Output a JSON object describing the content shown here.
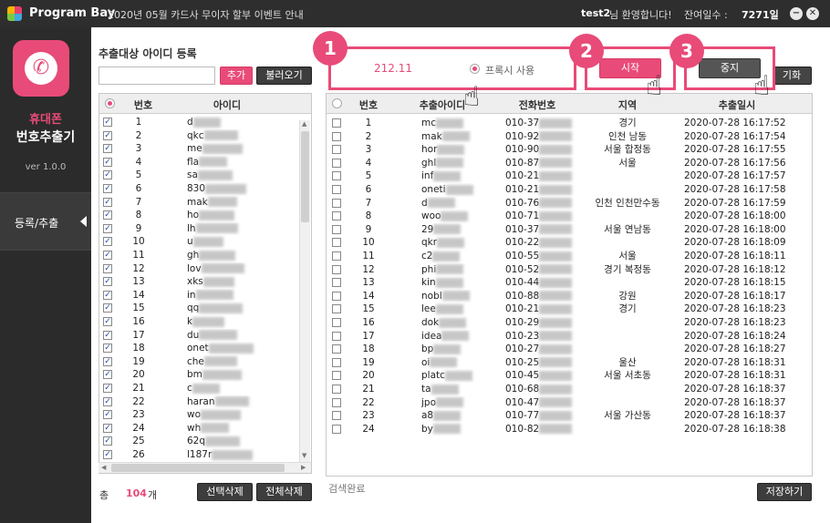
{
  "titlebar": {
    "brand": "Program Bay",
    "notice": "2020년 05월 카드사 무이자 할부 이벤트 안내",
    "user": "test2",
    "greeting": "님 환영합니다!",
    "days_label": "잔여일수 :",
    "days_value": "7271일",
    "minimize": "−",
    "close": "✕"
  },
  "sidebar": {
    "app_name_line1": "휴대폰",
    "app_name_line2": "번호추출기",
    "version": "ver 1.0.0",
    "nav_item": "등록/추출"
  },
  "left_panel": {
    "title": "추출대상 아이디 등록",
    "add_button": "추가",
    "load_button": "불러오기",
    "col_num": "번호",
    "col_id": "아이디",
    "ids": [
      "d",
      "qkc",
      "me",
      "fla",
      "sa",
      "830",
      "mak",
      "ho",
      "lh",
      "u",
      "gh",
      "lov",
      "xks",
      "in",
      "qq",
      "k",
      "du",
      "onet",
      "che",
      "bm",
      "c",
      "haran",
      "wo",
      "wh",
      "62q",
      "l187r"
    ],
    "total_label": "총",
    "total_count": "104",
    "total_unit": "개",
    "delete_selected": "선택삭제",
    "delete_all": "전체삭제"
  },
  "controls": {
    "proxy_ip": "212.11",
    "proxy_label": "프록시 사용",
    "start_button": "시작",
    "stop_button": "중지",
    "reset_button": "기화",
    "badges": [
      "1",
      "2",
      "3"
    ]
  },
  "right_panel": {
    "col_num": "번호",
    "col_id": "추출아이디",
    "col_phone": "전화번호",
    "col_region": "지역",
    "col_time": "추출일시",
    "rows": [
      {
        "id": "mc",
        "phone": "010-37",
        "region": "경기",
        "time": "2020-07-28 16:17:52"
      },
      {
        "id": "mak",
        "phone": "010-92",
        "region": "인천 남동",
        "time": "2020-07-28 16:17:54"
      },
      {
        "id": "hor",
        "phone": "010-90",
        "region": "서울 합정동",
        "time": "2020-07-28 16:17:55"
      },
      {
        "id": "ghl",
        "phone": "010-87",
        "region": "서울",
        "time": "2020-07-28 16:17:56"
      },
      {
        "id": "inf",
        "phone": "010-21",
        "region": "",
        "time": "2020-07-28 16:17:57"
      },
      {
        "id": "oneti",
        "phone": "010-21",
        "region": "",
        "time": "2020-07-28 16:17:58"
      },
      {
        "id": "d",
        "phone": "010-76",
        "region": "인천 인천만수동",
        "time": "2020-07-28 16:17:59"
      },
      {
        "id": "woo",
        "phone": "010-71",
        "region": "",
        "time": "2020-07-28 16:18:00"
      },
      {
        "id": "29",
        "phone": "010-37",
        "region": "서울 연남동",
        "time": "2020-07-28 16:18:00"
      },
      {
        "id": "qkr",
        "phone": "010-22",
        "region": "",
        "time": "2020-07-28 16:18:09"
      },
      {
        "id": "c2",
        "phone": "010-55",
        "region": "서울",
        "time": "2020-07-28 16:18:11"
      },
      {
        "id": "phi",
        "phone": "010-52",
        "region": "경기 복정동",
        "time": "2020-07-28 16:18:12"
      },
      {
        "id": "kin",
        "phone": "010-44",
        "region": "",
        "time": "2020-07-28 16:18:15"
      },
      {
        "id": "nobl",
        "phone": "010-88",
        "region": "강원",
        "time": "2020-07-28 16:18:17"
      },
      {
        "id": "lee",
        "phone": "010-21",
        "region": "경기",
        "time": "2020-07-28 16:18:23"
      },
      {
        "id": "dok",
        "phone": "010-29",
        "region": "",
        "time": "2020-07-28 16:18:23"
      },
      {
        "id": "idea",
        "phone": "010-23",
        "region": "",
        "time": "2020-07-28 16:18:24"
      },
      {
        "id": "bp",
        "phone": "010-27",
        "region": "",
        "time": "2020-07-28 16:18:27"
      },
      {
        "id": "oi",
        "phone": "010-25",
        "region": "울산",
        "time": "2020-07-28 16:18:31"
      },
      {
        "id": "platc",
        "phone": "010-45",
        "region": "서울 서초동",
        "time": "2020-07-28 16:18:31"
      },
      {
        "id": "ta",
        "phone": "010-68",
        "region": "",
        "time": "2020-07-28 16:18:37"
      },
      {
        "id": "jpo",
        "phone": "010-47",
        "region": "",
        "time": "2020-07-28 16:18:37"
      },
      {
        "id": "a8",
        "phone": "010-77",
        "region": "서울 가산동",
        "time": "2020-07-28 16:18:37"
      },
      {
        "id": "by",
        "phone": "010-82",
        "region": "",
        "time": "2020-07-28 16:18:38"
      }
    ],
    "status": "검색완료",
    "save_button": "저장하기"
  },
  "colors": {
    "accent": "#e84b78",
    "dark": "#2e2e2e"
  }
}
